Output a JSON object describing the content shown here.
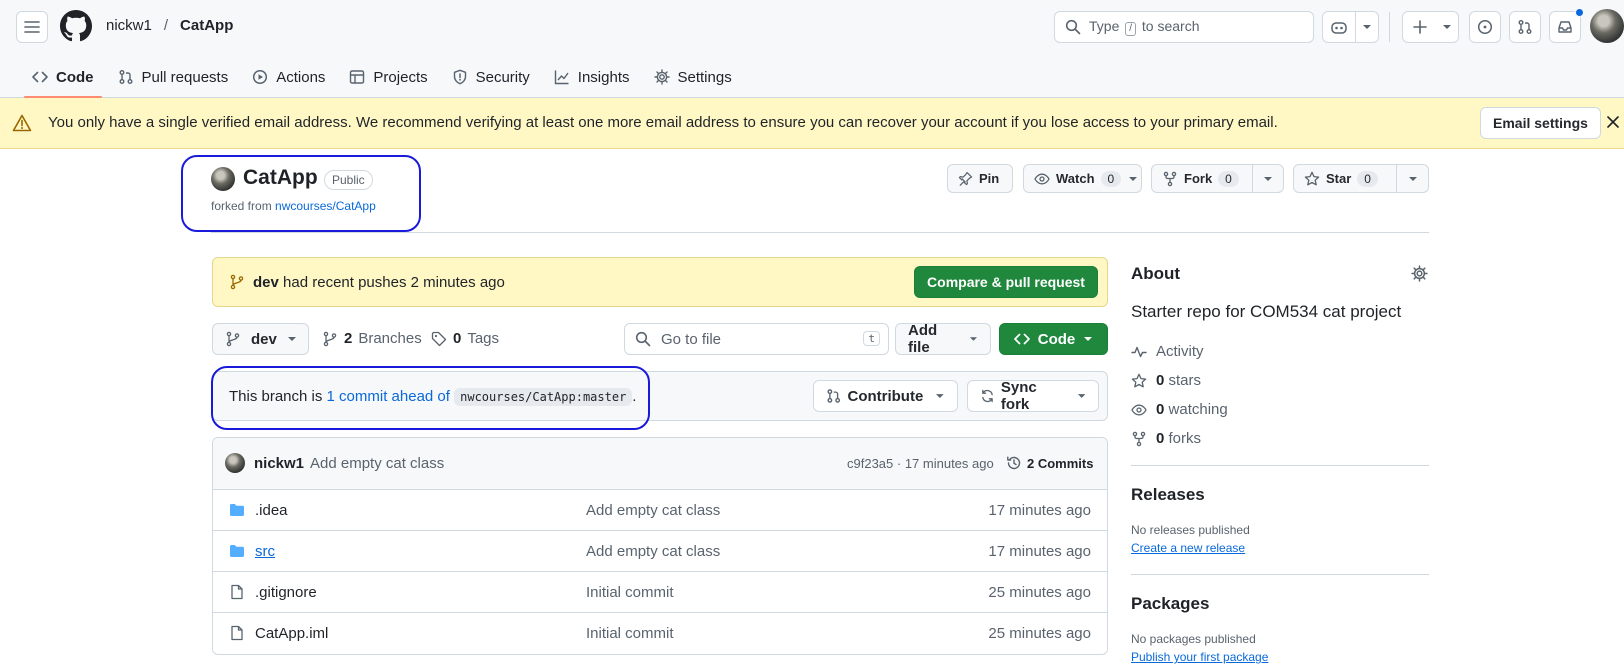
{
  "header": {
    "owner": "nickw1",
    "separator": "/",
    "repo": "CatApp",
    "search_before": "Type",
    "search_key": "/",
    "search_after": "to search"
  },
  "tabs": [
    {
      "label": "Code",
      "icon": "code-icon",
      "active": true
    },
    {
      "label": "Pull requests",
      "icon": "pull-request-icon"
    },
    {
      "label": "Actions",
      "icon": "play-icon"
    },
    {
      "label": "Projects",
      "icon": "table-icon"
    },
    {
      "label": "Security",
      "icon": "shield-icon"
    },
    {
      "label": "Insights",
      "icon": "graph-icon"
    },
    {
      "label": "Settings",
      "icon": "gear-icon"
    }
  ],
  "banner": {
    "text": "You only have a single verified email address. We recommend verifying at least one more email address to ensure you can recover your account if you lose access to your primary email.",
    "button": "Email settings"
  },
  "repo": {
    "name": "CatApp",
    "visibility": "Public",
    "forked_prefix": "forked from",
    "forked_from": "nwcourses/CatApp",
    "pin": "Pin",
    "watch": "Watch",
    "watch_count": "0",
    "fork": "Fork",
    "fork_count": "0",
    "star": "Star",
    "star_count": "0"
  },
  "push": {
    "branch": "dev",
    "text": "had recent pushes 2 minutes ago",
    "button": "Compare & pull request"
  },
  "toolbar": {
    "branch": "dev",
    "branches_count": "2",
    "branches_label": "Branches",
    "tags_count": "0",
    "tags_label": "Tags",
    "go_to_file": "Go to file",
    "go_to_file_key": "t",
    "add_file": "Add file",
    "code": "Code"
  },
  "ahead": {
    "prefix": "This branch is",
    "link": "1 commit ahead of",
    "ref": "nwcourses/CatApp:master",
    "suffix": ".",
    "contribute": "Contribute",
    "sync": "Sync fork"
  },
  "latest_commit": {
    "author": "nickw1",
    "message": "Add empty cat class",
    "hash_time": "c9f23a5 · 17 minutes ago",
    "commits_label": "2 Commits"
  },
  "files": [
    {
      "name": ".idea",
      "type": "folder",
      "message": "Add empty cat class",
      "age": "17 minutes ago"
    },
    {
      "name": "src",
      "type": "folder",
      "message": "Add empty cat class",
      "age": "17 minutes ago"
    },
    {
      "name": ".gitignore",
      "type": "file",
      "message": "Initial commit",
      "age": "25 minutes ago"
    },
    {
      "name": "CatApp.iml",
      "type": "file",
      "message": "Initial commit",
      "age": "25 minutes ago"
    }
  ],
  "about": {
    "title": "About",
    "description": "Starter repo for COM534 cat project",
    "activity": "Activity",
    "stars_count": "0",
    "stars_label": "stars",
    "watching_count": "0",
    "watching_label": "watching",
    "forks_count": "0",
    "forks_label": "forks"
  },
  "releases": {
    "title": "Releases",
    "none": "No releases published",
    "create": "Create a new release"
  },
  "packages": {
    "title": "Packages",
    "none": "No packages published",
    "publish": "Publish your first package"
  },
  "colors": {
    "accent": "#0969da",
    "green": "#1f883d",
    "banner": "#fff8c5",
    "annotation": "#1a1adb"
  }
}
